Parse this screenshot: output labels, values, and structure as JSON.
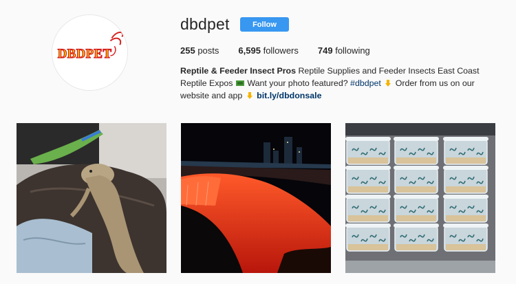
{
  "profile": {
    "username": "dbdpet",
    "follow_label": "Follow",
    "avatar_text": "DBDPET",
    "stats": {
      "posts_count": "255",
      "posts_label": "posts",
      "followers_count": "6,595",
      "followers_label": "followers",
      "following_count": "749",
      "following_label": "following"
    },
    "bio": {
      "name": "Reptile & Feeder Insect Pros",
      "text1": " Reptile Supplies and Feeder Insects East Coast Reptile Expos ",
      "text2": " Want your photo featured? ",
      "hashtag": "#dbdpet",
      "text3": " Order from us on our website and app ",
      "link": "bit.ly/dbdonsale"
    }
  },
  "posts": [
    {
      "subject": "bearded dragon on jacket"
    },
    {
      "subject": "niagara falls at night"
    },
    {
      "subject": "stacked cups of feeder insects"
    }
  ],
  "colors": {
    "follow_blue": "#3897f0",
    "link_blue": "#003569",
    "logo_red": "#d71f1f",
    "logo_yellow": "#f6d300"
  }
}
